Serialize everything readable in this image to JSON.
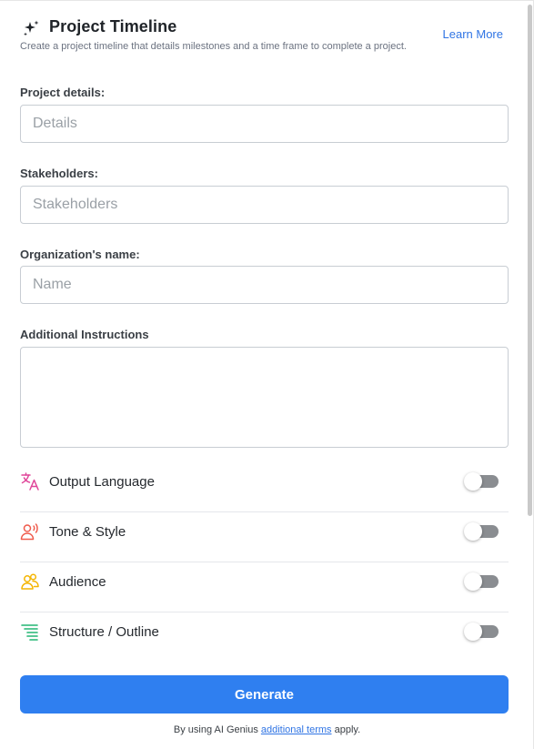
{
  "header": {
    "title": "Project Timeline",
    "subtitle": "Create a project timeline that details milestones and a time frame to complete a project.",
    "learn_more": "Learn More",
    "icon": "sparkle-icon"
  },
  "fields": [
    {
      "label": "Project details:",
      "placeholder": "Details",
      "value": ""
    },
    {
      "label": "Stakeholders:",
      "placeholder": "Stakeholders",
      "value": ""
    },
    {
      "label": "Organization's name:",
      "placeholder": "Name",
      "value": ""
    }
  ],
  "additional": {
    "label": "Additional Instructions",
    "value": ""
  },
  "options": [
    {
      "label": "Output Language",
      "icon": "translate-icon",
      "enabled": false,
      "icon_color": "#e0469a"
    },
    {
      "label": "Tone & Style",
      "icon": "voice-icon",
      "enabled": false,
      "icon_color": "#ef5b4c"
    },
    {
      "label": "Audience",
      "icon": "people-icon",
      "enabled": false,
      "icon_color": "#f4b400"
    },
    {
      "label": "Structure / Outline",
      "icon": "outline-icon",
      "enabled": false,
      "icon_color": "#22b573"
    }
  ],
  "generate_label": "Generate",
  "footer": {
    "prefix": "By using AI Genius ",
    "link": "additional terms",
    "suffix": " apply."
  },
  "colors": {
    "accent": "#2f7ff0",
    "link": "#2f74e4",
    "toggle_off": "#8a8d91"
  }
}
